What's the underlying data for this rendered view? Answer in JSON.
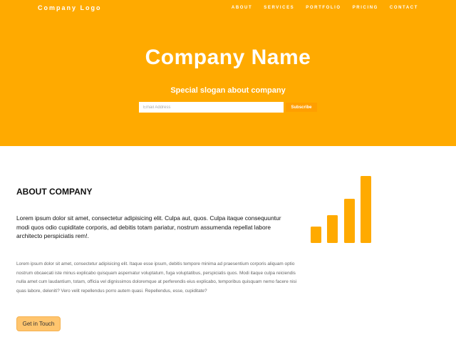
{
  "header": {
    "logo": "Company Logo",
    "nav": [
      "ABOUT",
      "SERVICES",
      "PORTFOLIO",
      "PRICING",
      "CONTACT"
    ]
  },
  "hero": {
    "title": "Company Name",
    "slogan": "Special slogan about company",
    "email_placeholder": "Email Address",
    "subscribe_label": "Subscribe"
  },
  "about": {
    "heading": "ABOUT COMPANY",
    "lead": "Lorem ipsum dolor sit amet, consectetur adipisicing elit. Culpa aut, quos. Culpa itaque consequuntur modi quos odio cupiditate corporis, ad debitis totam pariatur, nostrum assumenda repellat labore architecto perspiciatis rem!.",
    "body": "Lorem ipsum dolor sit amet, consectetur adipisicing elit. Itaque esse ipsum, debitis tempore minima ad praesentium corporis aliquam optio nostrum obcaecati iste minus explicabo quisquam aspernatur voluptatum, fuga voluptatibus, perspiciatis quos. Modi itaque culpa reiciendis nulla amet cum laudantium, totam, officia vel dignissimos doloremque at perferendis eius explicabo, temporibus quisquam nemo facere nisi quas labore, deleniti? Vero velit repellendus porro autem quasi. Repellendus, esse, cupiditate?",
    "cta_label": "Get in Touch",
    "icon": "bar-chart-icon"
  },
  "colors": {
    "accent": "#ffaa00",
    "button": "#ff9f00",
    "cta_bg": "#ffc56e"
  }
}
